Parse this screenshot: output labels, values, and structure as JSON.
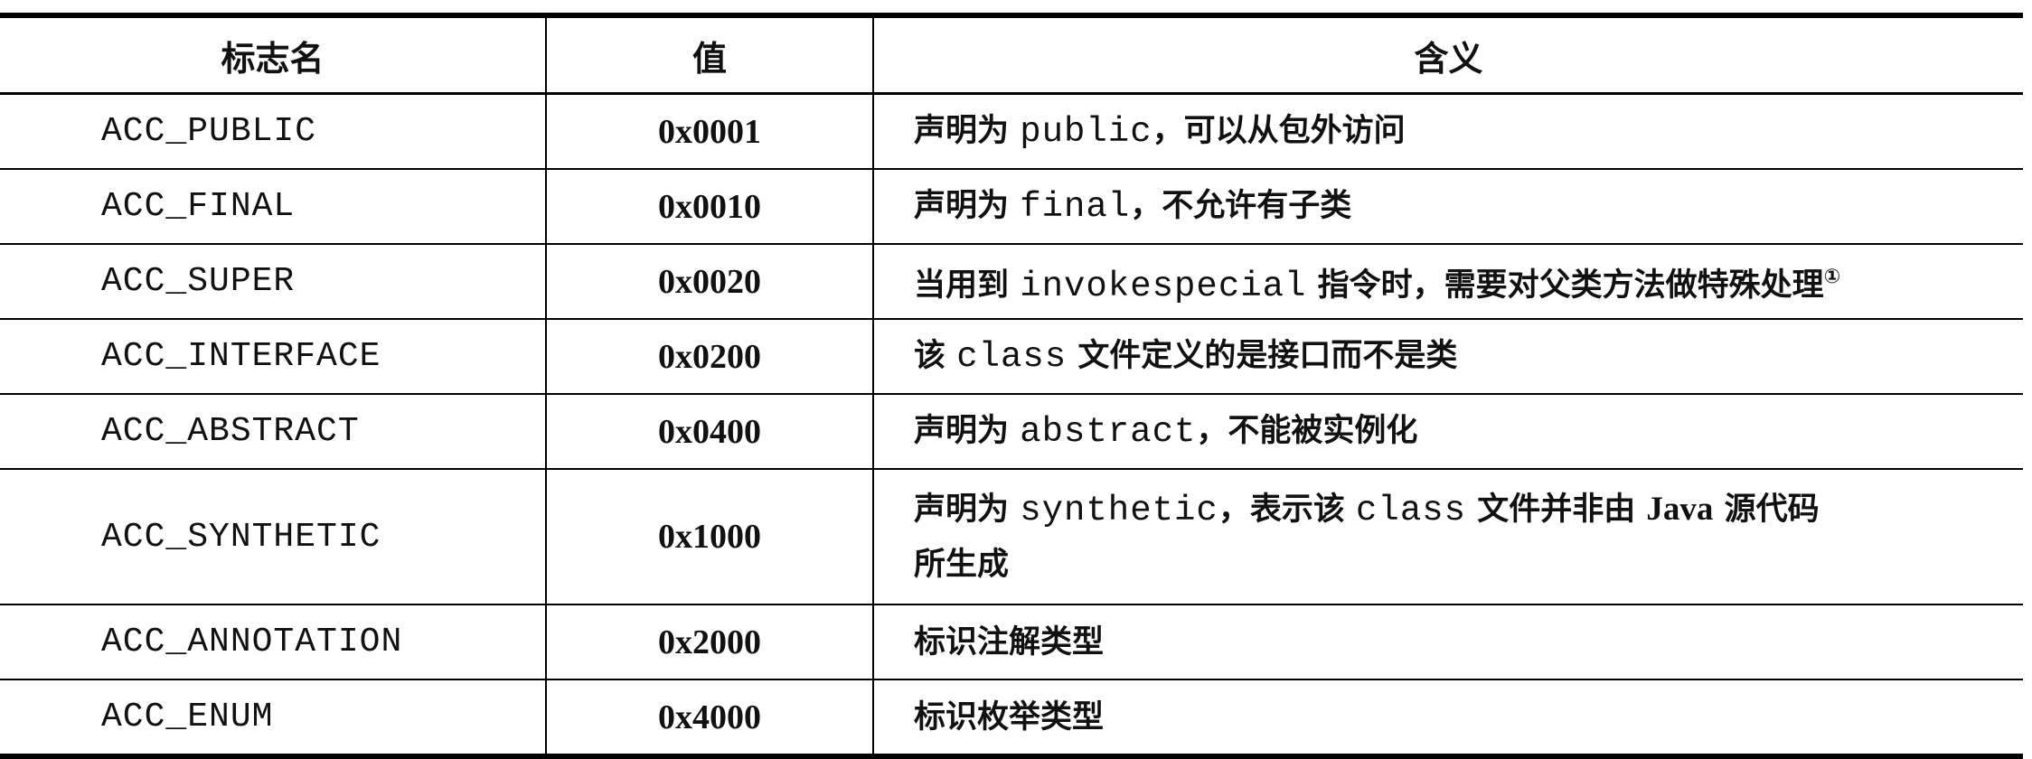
{
  "headers": [
    "标志名",
    "值",
    "含义"
  ],
  "rows": [
    {
      "name": "ACC_PUBLIC",
      "value": "0x0001",
      "desc": {
        "a": "声明为 ",
        "m": "public",
        "b": "，可以从包外访问"
      }
    },
    {
      "name": "ACC_FINAL",
      "value": "0x0010",
      "desc": {
        "a": "声明为 ",
        "m": "final",
        "b": "，不允许有子类"
      }
    },
    {
      "name": "ACC_SUPER",
      "value": "0x0020",
      "desc": {
        "a": "当用到 ",
        "m": "invokespecial",
        "b": " 指令时，需要对父类方法做特殊处理",
        "sup": "①"
      }
    },
    {
      "name": "ACC_INTERFACE",
      "value": "0x0200",
      "desc": {
        "a": "该 ",
        "m": "class",
        "b": " 文件定义的是接口而不是类"
      }
    },
    {
      "name": "ACC_ABSTRACT",
      "value": "0x0400",
      "desc": {
        "a": "声明为 ",
        "m": "abstract",
        "b": "，不能被实例化"
      }
    },
    {
      "name": "ACC_SYNTHETIC",
      "value": "0x1000",
      "desc": {
        "a": "声明为 ",
        "m": "synthetic",
        "b": "，表示该 ",
        "m2": "class",
        "c": " 文件并非由 ",
        "s": "Java",
        "d": " 源代码",
        "e": "所生成"
      }
    },
    {
      "name": "ACC_ANNOTATION",
      "value": "0x2000",
      "desc": {
        "a": "标识注解类型"
      }
    },
    {
      "name": "ACC_ENUM",
      "value": "0x4000",
      "desc": {
        "a": "标识枚举类型"
      }
    }
  ]
}
